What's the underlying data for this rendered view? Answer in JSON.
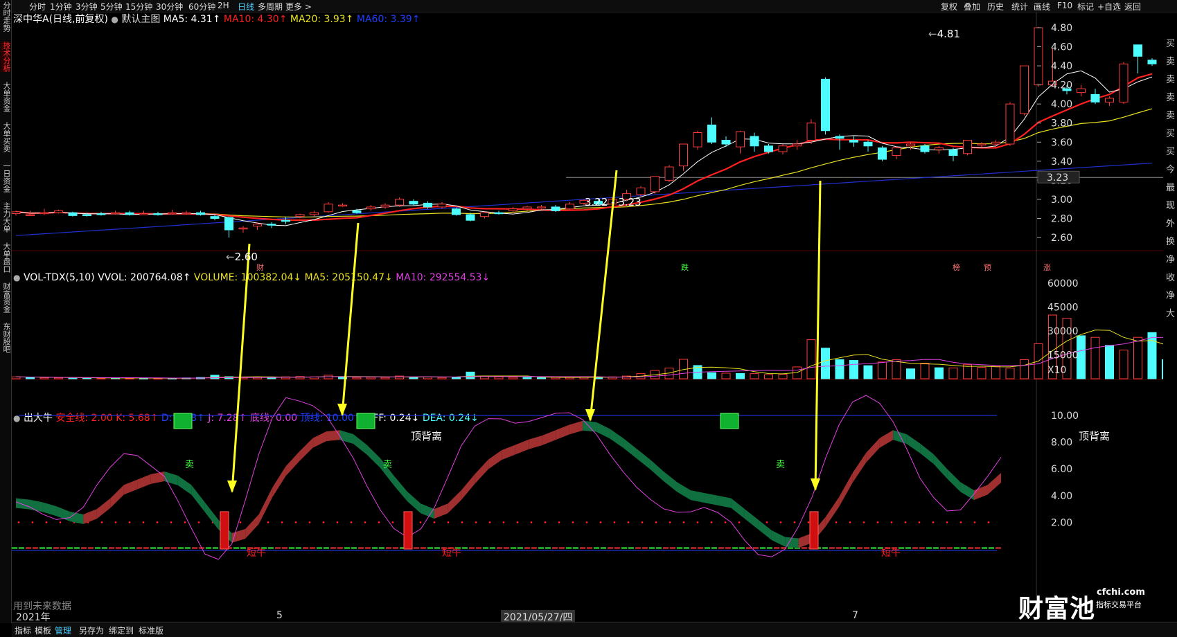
{
  "sidebar": {
    "items": [
      {
        "label": "分时走势",
        "active": false
      },
      {
        "label": "技术分析",
        "active": true
      },
      {
        "label": "大单资金",
        "active": false
      },
      {
        "label": "大单买卖",
        "active": false
      },
      {
        "label": "一日资金",
        "active": false
      },
      {
        "label": "主力大单",
        "active": false
      },
      {
        "label": "大单盘口",
        "active": false
      },
      {
        "label": "财富资金",
        "active": false
      },
      {
        "label": "东财股吧",
        "active": false
      }
    ]
  },
  "topbar": {
    "periods": [
      "分时",
      "1分钟",
      "3分钟",
      "5分钟",
      "15分钟",
      "30分钟",
      "60分钟",
      "2H",
      "日线",
      "多周期",
      "更多 >"
    ],
    "selected": "日线",
    "tools": [
      "复权",
      "叠加",
      "历史",
      "统计",
      "画线",
      "F10",
      "标记",
      "+自选",
      "返回"
    ]
  },
  "main_header": {
    "name": "深中华A(日线,前复权)",
    "template": "默认主图",
    "ma5": "MA5: 4.31↑",
    "ma10": "MA10: 4.30↑",
    "ma20": "MA20: 3.93↑",
    "ma60": "MA60: 3.39↑"
  },
  "vol_header": {
    "name": "VOL-TDX(5,10)",
    "vvol": "VVOL: 200764.08↑",
    "volume": "VOLUME: 100382.04↓",
    "ma5": "MA5: 205150.47↓",
    "ma10": "MA10: 292554.53↓"
  },
  "ind_header": {
    "name": "出大牛",
    "safe": "安全线: 2.00",
    "k": "K: 5.68↑",
    "d": "D: 4.88↑",
    "j": "J: 7.28↑",
    "bottom": "底线: 0.00",
    "top": "顶线: 10.00",
    "diff": "DIFF: 0.24↓",
    "dea": "DEA: 0.24↓"
  },
  "price_axis": [
    "4.80",
    "4.60",
    "4.40",
    "4.20",
    "4.00",
    "3.80",
    "3.60",
    "3.40",
    "3.20",
    "3.00",
    "2.80",
    "2.60"
  ],
  "price_marker": "3.23",
  "vol_axis": [
    "60000",
    "45000",
    "30000",
    "15000",
    "X10"
  ],
  "ind_axis": [
    "10.00",
    "8.00",
    "6.00",
    "4.00",
    "2.00"
  ],
  "annotations": {
    "high": "4.81",
    "low": "2.60",
    "range": "3.22 - 3.23",
    "top_divergence_1": "顶背离",
    "top_divergence_2": "顶背离",
    "short_bull": "短牛",
    "sell": "卖",
    "note": "用到未来数据",
    "tags": [
      "财",
      "跌",
      "榜",
      "预",
      "涨"
    ]
  },
  "dates": {
    "year": "2021年",
    "m5": "5",
    "cursor": "2021/05/27/四",
    "m7": "7"
  },
  "bottombar": [
    "指标",
    "模板",
    "管理",
    "另存为",
    "绑定到",
    "标准版"
  ],
  "bottombar_selected": "管理",
  "watermark": {
    "brand": "财富池",
    "site": "cfchi.com",
    "sub": "指标交易平台"
  },
  "right_strip": [
    "买",
    "卖",
    "卖",
    "卖",
    "卖",
    "买",
    "买",
    "今",
    "最",
    "现",
    "外",
    "换",
    "净",
    "收",
    "净",
    "大"
  ],
  "colors": {
    "up": "#ff3b3b",
    "down": "#4dfcff",
    "ma5": "#ffffff",
    "ma10": "#ff2020",
    "ma20": "#e8e020",
    "ma60": "#2030d0",
    "magenta": "#e040e0",
    "ribbon_up": "#a03030",
    "ribbon_down": "#107040",
    "arrow": "#ffff20"
  },
  "chart_data": {
    "type": "candlestick",
    "candles": [
      [
        2.85,
        2.87,
        2.88,
        2.83
      ],
      [
        2.84,
        2.84,
        2.88,
        2.83
      ],
      [
        2.86,
        2.86,
        2.9,
        2.84
      ],
      [
        2.86,
        2.88,
        2.89,
        2.85
      ],
      [
        2.86,
        2.83,
        2.87,
        2.82
      ],
      [
        2.84,
        2.83,
        2.86,
        2.82
      ],
      [
        2.85,
        2.84,
        2.87,
        2.83
      ],
      [
        2.85,
        2.86,
        2.88,
        2.84
      ],
      [
        2.86,
        2.84,
        2.88,
        2.83
      ],
      [
        2.85,
        2.85,
        2.88,
        2.84
      ],
      [
        2.85,
        2.84,
        2.87,
        2.83
      ],
      [
        2.85,
        2.86,
        2.89,
        2.84
      ],
      [
        2.86,
        2.86,
        2.88,
        2.84
      ],
      [
        2.86,
        2.84,
        2.88,
        2.83
      ],
      [
        2.82,
        2.8,
        2.84,
        2.78
      ],
      [
        2.81,
        2.68,
        2.82,
        2.6
      ],
      [
        2.69,
        2.7,
        2.72,
        2.65
      ],
      [
        2.72,
        2.74,
        2.76,
        2.68
      ],
      [
        2.74,
        2.73,
        2.76,
        2.7
      ],
      [
        2.78,
        2.77,
        2.82,
        2.74
      ],
      [
        2.82,
        2.84,
        2.85,
        2.8
      ],
      [
        2.84,
        2.86,
        2.88,
        2.82
      ],
      [
        2.87,
        2.95,
        2.97,
        2.86
      ],
      [
        2.94,
        2.94,
        2.96,
        2.92
      ],
      [
        2.88,
        2.86,
        2.9,
        2.85
      ],
      [
        2.9,
        2.92,
        2.94,
        2.88
      ],
      [
        2.92,
        2.94,
        2.96,
        2.9
      ],
      [
        2.94,
        3.0,
        3.02,
        2.92
      ],
      [
        2.98,
        2.95,
        3.0,
        2.93
      ],
      [
        2.96,
        2.92,
        2.98,
        2.9
      ],
      [
        2.92,
        2.95,
        2.97,
        2.9
      ],
      [
        2.9,
        2.84,
        2.91,
        2.83
      ],
      [
        2.84,
        2.78,
        2.86,
        2.77
      ],
      [
        2.82,
        2.86,
        2.87,
        2.8
      ],
      [
        2.86,
        2.85,
        2.88,
        2.84
      ],
      [
        2.88,
        2.9,
        2.92,
        2.86
      ],
      [
        2.9,
        2.92,
        2.93,
        2.88
      ],
      [
        2.92,
        2.92,
        2.94,
        2.9
      ],
      [
        2.92,
        2.88,
        2.94,
        2.87
      ],
      [
        2.9,
        2.95,
        2.97,
        2.89
      ],
      [
        2.96,
        2.99,
        3.0,
        2.94
      ],
      [
        2.98,
        2.95,
        3.0,
        2.94
      ],
      [
        2.95,
        3.0,
        3.02,
        2.93
      ],
      [
        3.0,
        3.06,
        3.1,
        2.98
      ],
      [
        3.05,
        3.12,
        3.14,
        3.03
      ],
      [
        3.08,
        3.24,
        3.24,
        3.06
      ],
      [
        3.2,
        3.34,
        3.36,
        3.18
      ],
      [
        3.35,
        3.58,
        3.58,
        3.3
      ],
      [
        3.55,
        3.7,
        3.72,
        3.52
      ],
      [
        3.78,
        3.6,
        3.86,
        3.58
      ],
      [
        3.62,
        3.58,
        3.66,
        3.55
      ],
      [
        3.55,
        3.71,
        3.72,
        3.48
      ],
      [
        3.66,
        3.56,
        3.7,
        3.5
      ],
      [
        3.56,
        3.5,
        3.58,
        3.48
      ],
      [
        3.5,
        3.56,
        3.58,
        3.47
      ],
      [
        3.56,
        3.58,
        3.62,
        3.52
      ],
      [
        3.62,
        3.8,
        3.84,
        3.58
      ],
      [
        4.26,
        3.72,
        4.28,
        3.68
      ],
      [
        3.66,
        3.64,
        3.68,
        3.52
      ],
      [
        3.62,
        3.6,
        3.66,
        3.55
      ],
      [
        3.6,
        3.56,
        3.62,
        3.5
      ],
      [
        3.54,
        3.42,
        3.56,
        3.4
      ],
      [
        3.46,
        3.54,
        3.56,
        3.42
      ],
      [
        3.56,
        3.58,
        3.6,
        3.52
      ],
      [
        3.56,
        3.5,
        3.58,
        3.48
      ],
      [
        3.52,
        3.54,
        3.56,
        3.48
      ],
      [
        3.52,
        3.46,
        3.54,
        3.4
      ],
      [
        3.48,
        3.62,
        3.62,
        3.46
      ],
      [
        3.58,
        3.58,
        3.6,
        3.54
      ],
      [
        3.58,
        3.6,
        3.62,
        3.54
      ],
      [
        3.58,
        4.0,
        4.02,
        3.56
      ],
      [
        3.9,
        4.4,
        4.4,
        3.88
      ],
      [
        4.2,
        4.8,
        4.81,
        4.18
      ],
      [
        4.2,
        4.24,
        4.58,
        4.18
      ],
      [
        4.16,
        4.14,
        4.2,
        4.1
      ],
      [
        4.12,
        4.16,
        4.2,
        4.08
      ],
      [
        4.1,
        4.02,
        4.16,
        4.0
      ],
      [
        4.02,
        4.06,
        4.08,
        3.98
      ],
      [
        4.02,
        4.42,
        4.44,
        4.0
      ],
      [
        4.62,
        4.5,
        4.62,
        4.32
      ],
      [
        4.46,
        4.42,
        4.48,
        4.4
      ]
    ],
    "volume": [
      [
        1200,
        1
      ],
      [
        1000,
        0
      ],
      [
        700,
        1
      ],
      [
        600,
        1
      ],
      [
        400,
        0
      ],
      [
        500,
        0
      ],
      [
        400,
        1
      ],
      [
        500,
        0
      ],
      [
        400,
        1
      ],
      [
        300,
        0
      ],
      [
        300,
        1
      ],
      [
        300,
        0
      ],
      [
        500,
        0
      ],
      [
        800,
        0
      ],
      [
        2200,
        0
      ],
      [
        1300,
        0
      ],
      [
        800,
        1
      ],
      [
        1100,
        1
      ],
      [
        500,
        0
      ],
      [
        1200,
        1
      ],
      [
        1400,
        1
      ],
      [
        1200,
        1
      ],
      [
        2200,
        1
      ],
      [
        1200,
        0
      ],
      [
        800,
        1
      ],
      [
        900,
        1
      ],
      [
        800,
        1
      ],
      [
        1700,
        1
      ],
      [
        1100,
        0
      ],
      [
        1100,
        1
      ],
      [
        800,
        1
      ],
      [
        900,
        0
      ],
      [
        4200,
        0
      ],
      [
        1600,
        1
      ],
      [
        1200,
        1
      ],
      [
        900,
        1
      ],
      [
        800,
        0
      ],
      [
        700,
        0
      ],
      [
        900,
        1
      ],
      [
        900,
        1
      ],
      [
        1000,
        1
      ],
      [
        1000,
        0
      ],
      [
        1200,
        1
      ],
      [
        1700,
        1
      ],
      [
        3200,
        1
      ],
      [
        5200,
        1
      ],
      [
        6700,
        1
      ],
      [
        12200,
        1
      ],
      [
        8300,
        0
      ],
      [
        3800,
        0
      ],
      [
        3500,
        1
      ],
      [
        3300,
        0
      ],
      [
        3200,
        1
      ],
      [
        2600,
        1
      ],
      [
        2800,
        1
      ],
      [
        7400,
        1
      ],
      [
        24500,
        1
      ],
      [
        19200,
        0
      ],
      [
        12000,
        0
      ],
      [
        11500,
        0
      ],
      [
        8200,
        0
      ],
      [
        10500,
        1
      ],
      [
        12000,
        1
      ],
      [
        6200,
        0
      ],
      [
        9800,
        1
      ],
      [
        6900,
        0
      ],
      [
        6800,
        1
      ],
      [
        8800,
        1
      ],
      [
        7100,
        1
      ],
      [
        7700,
        1
      ],
      [
        6700,
        1
      ],
      [
        12000,
        1
      ],
      [
        22000,
        1
      ],
      [
        40000,
        1
      ],
      [
        38000,
        1
      ],
      [
        27000,
        0
      ],
      [
        26000,
        1
      ],
      [
        21000,
        0
      ],
      [
        18000,
        1
      ],
      [
        26000,
        1
      ],
      [
        29000,
        0
      ],
      [
        12000,
        0
      ]
    ],
    "k_line": [
      3.8,
      3.7,
      3.5,
      3.2,
      2.8,
      2.6,
      3.0,
      3.8,
      4.8,
      5.2,
      5.6,
      5.8,
      5.5,
      4.8,
      3.5,
      2.2,
      1.2,
      1.5,
      2.6,
      4.6,
      6.2,
      7.3,
      8.3,
      8.8,
      8.9,
      8.6,
      7.8,
      6.8,
      5.5,
      4.3,
      3.4,
      3.0,
      3.4,
      4.4,
      5.6,
      6.7,
      7.4,
      7.8,
      8.2,
      8.5,
      8.9,
      9.3,
      9.6,
      9.5,
      9.0,
      8.3,
      7.5,
      6.7,
      5.8,
      5.0,
      4.4,
      4.2,
      4.0,
      3.8,
      3.0,
      2.2,
      1.4,
      0.9,
      0.8,
      1.2,
      2.4,
      3.9,
      5.7,
      7.2,
      8.3,
      8.9,
      8.6,
      7.9,
      7.1,
      6.0,
      5.0,
      4.4,
      4.8,
      5.7
    ]
  }
}
